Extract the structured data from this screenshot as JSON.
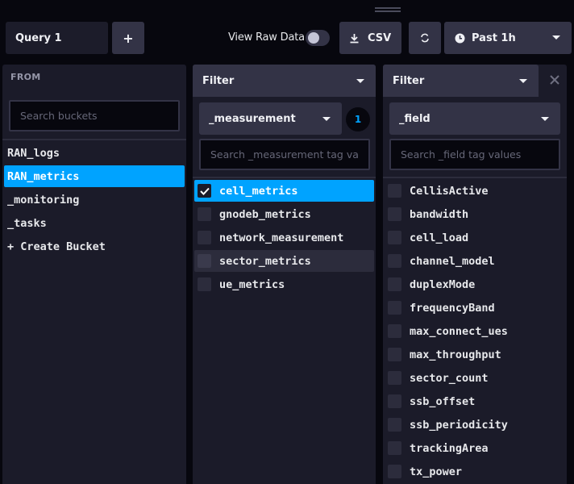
{
  "toolbar": {
    "query_tab_label": "Query 1",
    "add_query_label": "+",
    "view_raw_data_label": "View Raw Data",
    "view_raw_data_on": false,
    "csv_label": "CSV",
    "time_range_label": "Past 1h"
  },
  "from": {
    "title": "FROM",
    "search_placeholder": "Search buckets",
    "buckets": [
      {
        "label": "RAN_logs",
        "selected": false
      },
      {
        "label": "RAN_metrics",
        "selected": true
      },
      {
        "label": "_monitoring",
        "selected": false
      },
      {
        "label": "_tasks",
        "selected": false
      },
      {
        "label": "+ Create Bucket",
        "selected": false
      }
    ]
  },
  "filters": [
    {
      "header_label": "Filter",
      "key": "_measurement",
      "selected_count": "1",
      "search_placeholder": "Search _measurement tag va",
      "values": [
        {
          "label": "cell_metrics",
          "checked": true
        },
        {
          "label": "gnodeb_metrics",
          "checked": false
        },
        {
          "label": "network_measurement",
          "checked": false
        },
        {
          "label": "sector_metrics",
          "checked": false,
          "hovered": true
        },
        {
          "label": "ue_metrics",
          "checked": false
        }
      ]
    },
    {
      "header_label": "Filter",
      "key": "_field",
      "search_placeholder": "Search _field tag values",
      "values": [
        {
          "label": "CellisActive",
          "checked": false
        },
        {
          "label": "bandwidth",
          "checked": false
        },
        {
          "label": "cell_load",
          "checked": false
        },
        {
          "label": "channel_model",
          "checked": false
        },
        {
          "label": "duplexMode",
          "checked": false
        },
        {
          "label": "frequencyBand",
          "checked": false
        },
        {
          "label": "max_connect_ues",
          "checked": false
        },
        {
          "label": "max_throughput",
          "checked": false
        },
        {
          "label": "sector_count",
          "checked": false
        },
        {
          "label": "ssb_offset",
          "checked": false
        },
        {
          "label": "ssb_periodicity",
          "checked": false
        },
        {
          "label": "trackingArea",
          "checked": false
        },
        {
          "label": "tx_power",
          "checked": false
        }
      ]
    }
  ],
  "colors": {
    "accent": "#00a3ff",
    "background": "#07070e",
    "panel": "#1b1b29",
    "control": "#333346"
  }
}
